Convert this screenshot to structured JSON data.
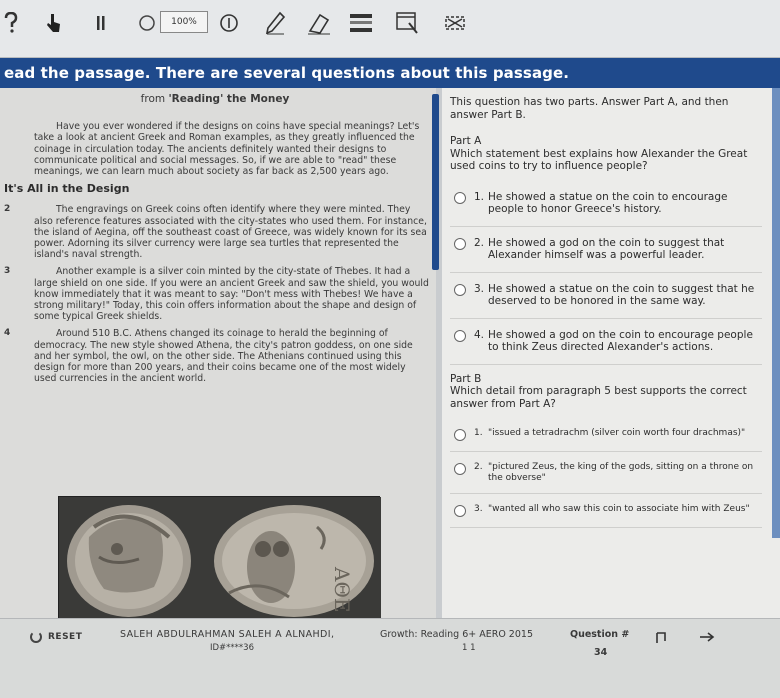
{
  "toolbar": {
    "zoom": "100%",
    "icons": [
      "help-icon",
      "pointer-icon",
      "pause-icon",
      "comment-icon",
      "zoom-in-icon",
      "pen-icon",
      "eraser-icon",
      "line-reader-icon",
      "highlighter-icon",
      "masking-icon"
    ]
  },
  "instruction": "ead the passage. There are several questions about this passage.",
  "passage": {
    "source_prefix": "from ",
    "source_title": "'Reading' the Money",
    "p1": "Have you ever wondered if the designs on coins have special meanings? Let's take a look at ancient Greek and Roman examples, as they greatly influenced the coinage in circulation today. The ancients definitely wanted their designs to communicate political and social messages. So, if we are able to \"read\" these meanings, we can learn much about society as far back as 2,500 years ago.",
    "heading": "It's All in the Design",
    "p2_num": "2",
    "p2": "The engravings on Greek coins often identify where they were minted. They also reference features associated with the city-states who used them. For instance, the island of Aegina, off the southeast coast of Greece, was widely known for its sea power. Adorning its silver currency were large sea turtles that represented the island's naval strength.",
    "p3_num": "3",
    "p3": "Another example is a silver coin minted by the city-state of Thebes. It had a large shield on one side. If you were an ancient Greek and saw the shield, you would know immediately that it was meant to say: \"Don't mess with Thebes! We have a strong military!\" Today, this coin offers information about the shape and design of some typical Greek shields.",
    "p4_num": "4",
    "p4": "Around 510 B.C. Athens changed its coinage to herald the beginning of democracy. The new style showed Athena, the city's patron goddess, on one side and her symbol, the owl, on the other side. The Athenians continued using this design for more than 200 years, and their coins became one of the most widely used currencies in the ancient world."
  },
  "question": {
    "intro": "This question has two parts. Answer Part A, and then answer Part B.",
    "part_a_label": "Part A",
    "part_a_prompt": "Which statement best explains how Alexander the Great used coins to try to influence people?",
    "part_a_options": [
      {
        "num": "1.",
        "text": "He showed a statue on the coin to encourage people to honor Greece's history."
      },
      {
        "num": "2.",
        "text": "He showed a god on the coin to suggest that Alexander himself was a powerful leader."
      },
      {
        "num": "3.",
        "text": "He showed a statue on the coin to suggest that he deserved to be honored in the same way."
      },
      {
        "num": "4.",
        "text": "He showed a god on the coin to encourage people to think Zeus directed Alexander's actions."
      }
    ],
    "part_b_label": "Part B",
    "part_b_prompt": "Which detail from paragraph 5 best supports the correct answer from Part A?",
    "part_b_options": [
      {
        "num": "1.",
        "text": "\"issued a tetradrachm (silver coin worth four drachmas)\""
      },
      {
        "num": "2.",
        "text": "\"pictured Zeus, the king of the gods, sitting on a throne on the obverse\""
      },
      {
        "num": "3.",
        "text": "\"wanted all who saw this coin to associate him with Zeus\""
      }
    ]
  },
  "footer": {
    "reset": "RESET",
    "student": "SALEH ABDULRAHMAN SALEH A ALNAHDI,",
    "student_id": "ID#****36",
    "test_name": "Growth: Reading 6+ AERO 2015",
    "test_page": "1 1",
    "question_label": "Question #",
    "question_number": "34"
  }
}
